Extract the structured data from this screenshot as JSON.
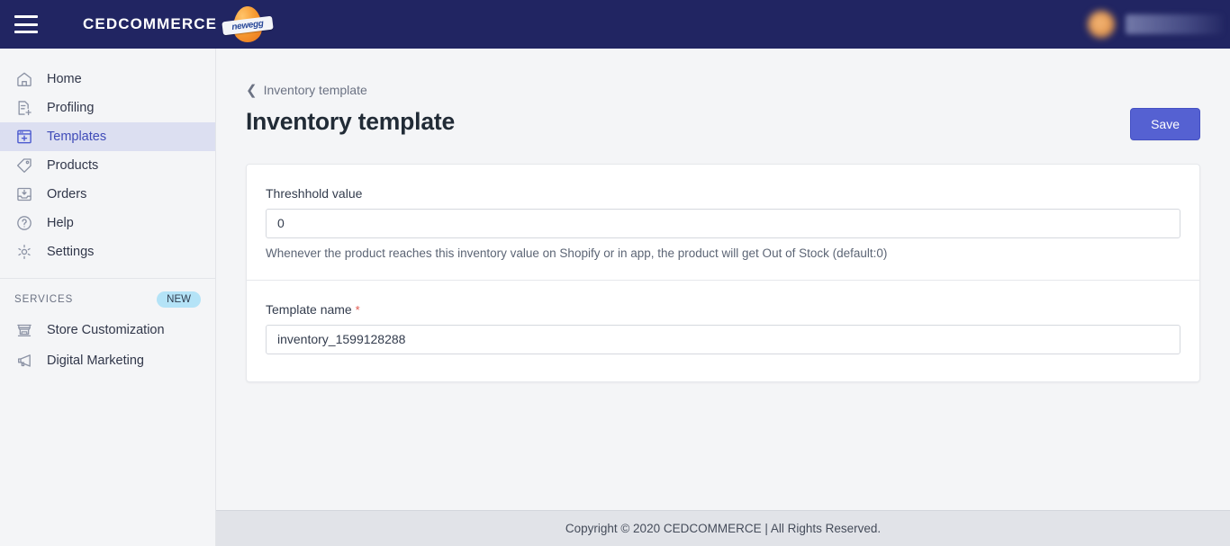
{
  "topbar": {
    "menu_icon": "hamburger-icon",
    "brand_text": "CEDCOMMERCE",
    "marketplace_logo_text": "newegg",
    "user_name_redacted": ""
  },
  "sidebar": {
    "items": [
      {
        "label": "Home",
        "icon": "home-icon",
        "active": false
      },
      {
        "label": "Profiling",
        "icon": "document-plus-icon",
        "active": false
      },
      {
        "label": "Templates",
        "icon": "template-plus-icon",
        "active": true
      },
      {
        "label": "Products",
        "icon": "tag-icon",
        "active": false
      },
      {
        "label": "Orders",
        "icon": "inbox-download-icon",
        "active": false
      },
      {
        "label": "Help",
        "icon": "question-circle-icon",
        "active": false
      },
      {
        "label": "Settings",
        "icon": "gear-icon",
        "active": false
      }
    ],
    "services": {
      "heading": "SERVICES",
      "badge": "NEW",
      "items": [
        {
          "label": "Store Customization",
          "icon": "storefront-icon"
        },
        {
          "label": "Digital Marketing",
          "icon": "megaphone-icon"
        }
      ]
    }
  },
  "main": {
    "breadcrumb": {
      "label": "Inventory template",
      "icon": "chevron-left-icon"
    },
    "page_title": "Inventory template",
    "save_label": "Save",
    "form": {
      "threshold": {
        "label": "Threshhold value",
        "value": "0",
        "placeholder": "0",
        "help": "Whenever the product reaches this inventory value on Shopify or in app, the product will get Out of Stock (default:0)"
      },
      "template_name": {
        "label": "Template name",
        "required_marker": "*",
        "value": "inventory_1599128288",
        "placeholder": "Template name"
      }
    }
  },
  "footer": {
    "text": "Copyright © 2020 CEDCOMMERCE | All Rights Reserved."
  },
  "colors": {
    "topbar_bg": "#212562",
    "accent": "#5561d2",
    "active_nav_bg": "#dcdff1",
    "active_nav_text": "#3f4bb8",
    "page_bg": "#f4f5f7",
    "footer_bg": "#e1e3e8",
    "badge_bg": "#b4e3f7",
    "required_star": "#e0584e",
    "egg_orange": "#f79b31"
  }
}
